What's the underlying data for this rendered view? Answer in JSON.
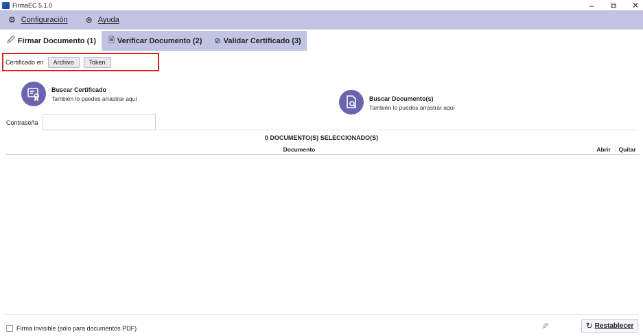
{
  "window": {
    "title": "FirmaEC 5.1.0",
    "controls": {
      "minimize": "–",
      "restore": "⧉",
      "close": "✕"
    }
  },
  "menubar": {
    "items": [
      {
        "label": "Configuración",
        "icon": "gear-icon",
        "glyph": "⚙"
      },
      {
        "label": "Ayuda",
        "icon": "help-icon",
        "glyph": "⊛"
      }
    ]
  },
  "tabs": [
    {
      "label": "Firmar Documento (1)",
      "icon": "sign-document-icon",
      "glyph": "🖉",
      "active": true
    },
    {
      "label": "Verificar Documento (2)",
      "icon": "verify-document-icon",
      "glyph": "🗎",
      "active": false
    },
    {
      "label": "Validar Certificado (3)",
      "icon": "validate-certificate-icon",
      "glyph": "⊘",
      "active": false
    }
  ],
  "certificate": {
    "label": "Certificado en",
    "file_button": "Archivo",
    "token_button": "Token",
    "highlight_color": "#e0201c"
  },
  "search_certificate": {
    "title": "Buscar Certificado",
    "subtitle": "También lo puedes arrastrar aquí",
    "icon": "certificate-icon"
  },
  "search_document": {
    "title": "Buscar Documento(s)",
    "subtitle": "También lo puedes arrastrar aquí",
    "icon": "document-search-icon"
  },
  "password": {
    "label": "Contraseña",
    "value": ""
  },
  "documents": {
    "count_text": "0 DOCUMENTO(S) SELECCIONADO(S)",
    "columns": [
      "Documento",
      "Abrir",
      "Quitar"
    ],
    "rows": []
  },
  "footer": {
    "invisible_signature_label": "Firma invisible (sólo para documentos PDF)",
    "invisible_signature_checked": false,
    "reset_button": "Restablecer"
  },
  "colors": {
    "menubar_bg": "#c3c3e3",
    "accent": "#6a64b0",
    "highlight": "#e0201c"
  }
}
